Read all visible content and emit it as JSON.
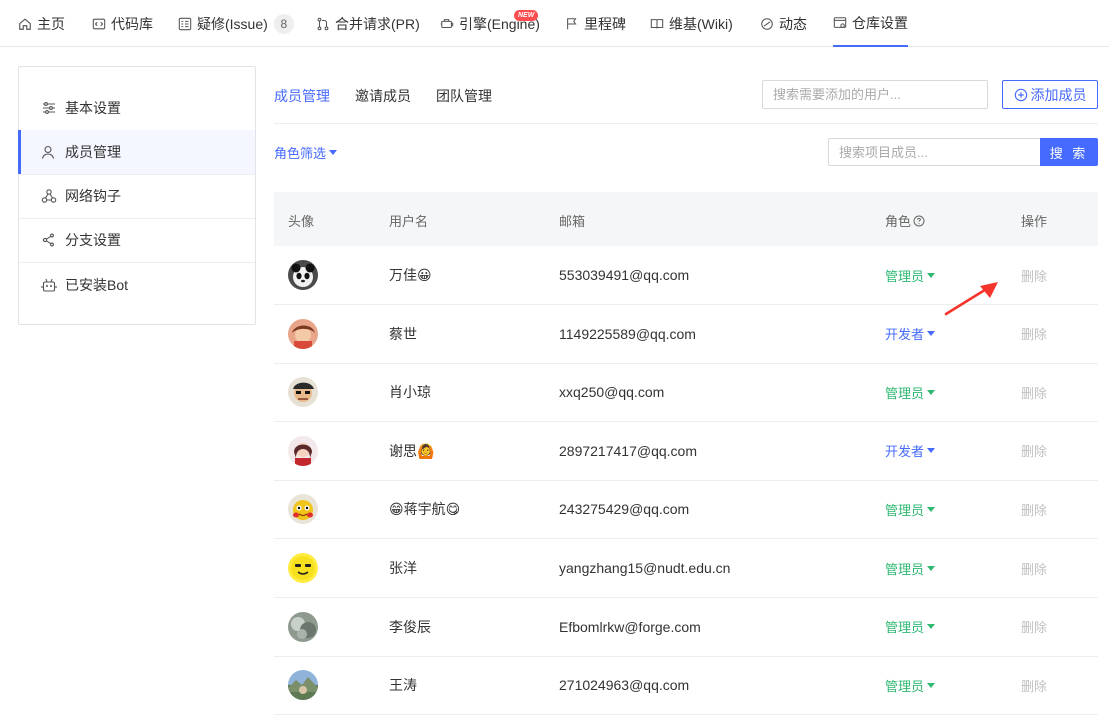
{
  "nav": {
    "items": [
      {
        "label": "主页",
        "icon": "home-icon"
      },
      {
        "label": "代码库",
        "icon": "code-icon"
      },
      {
        "label": "疑修(Issue)",
        "icon": "issue-icon",
        "count": "8"
      },
      {
        "label": "合并请求(PR)",
        "icon": "merge-icon"
      },
      {
        "label": "引擎(Engine)",
        "icon": "engine-icon",
        "badge": "NEW"
      },
      {
        "label": "里程碑",
        "icon": "flag-icon"
      },
      {
        "label": "维基(Wiki)",
        "icon": "book-icon"
      },
      {
        "label": "动态",
        "icon": "activity-icon"
      },
      {
        "label": "仓库设置",
        "icon": "settings-icon",
        "active": true
      }
    ]
  },
  "sidebar": {
    "items": [
      {
        "label": "基本设置",
        "icon": "sliders-icon"
      },
      {
        "label": "成员管理",
        "icon": "user-icon",
        "active": true
      },
      {
        "label": "网络钩子",
        "icon": "webhook-icon"
      },
      {
        "label": "分支设置",
        "icon": "branch-icon"
      },
      {
        "label": "已安装Bot",
        "icon": "bot-icon"
      }
    ]
  },
  "tabs": [
    {
      "label": "成员管理",
      "active": true
    },
    {
      "label": "邀请成员"
    },
    {
      "label": "团队管理"
    }
  ],
  "search_add": {
    "placeholder": "搜索需要添加的用户..."
  },
  "add_button": {
    "label": "添加成员"
  },
  "role_filter": {
    "label": "角色筛选"
  },
  "search_member": {
    "placeholder": "搜索项目成员...",
    "button": "搜 索"
  },
  "table": {
    "headers": {
      "avatar": "头像",
      "username": "用户名",
      "email": "邮箱",
      "role": "角色",
      "action": "操作"
    },
    "rows": [
      {
        "username": "万佳😀",
        "email": "553039491@qq.com",
        "role": "管理员",
        "role_type": "admin",
        "action": "删除"
      },
      {
        "username": "蔡世",
        "email": "1149225589@qq.com",
        "role": "开发者",
        "role_type": "dev",
        "action": "删除"
      },
      {
        "username": "肖小琼",
        "email": "xxq250@qq.com",
        "role": "管理员",
        "role_type": "admin",
        "action": "删除"
      },
      {
        "username": "谢思🙆",
        "email": "2897217417@qq.com",
        "role": "开发者",
        "role_type": "dev",
        "action": "删除"
      },
      {
        "username": "😁蒋宇航😋",
        "email": "243275429@qq.com",
        "role": "管理员",
        "role_type": "admin",
        "action": "删除"
      },
      {
        "username": "张洋",
        "email": "yangzhang15@nudt.edu.cn",
        "role": "管理员",
        "role_type": "admin",
        "action": "删除"
      },
      {
        "username": "李俊辰",
        "email": "Efbomlrkw@forge.com",
        "role": "管理员",
        "role_type": "admin",
        "action": "删除"
      },
      {
        "username": "王涛",
        "email": "271024963@qq.com",
        "role": "管理员",
        "role_type": "admin",
        "action": "删除"
      }
    ]
  },
  "colors": {
    "accent": "#466afd",
    "admin": "#2eb872",
    "dev": "#466afd",
    "annotation_arrow": "#f5352b"
  }
}
